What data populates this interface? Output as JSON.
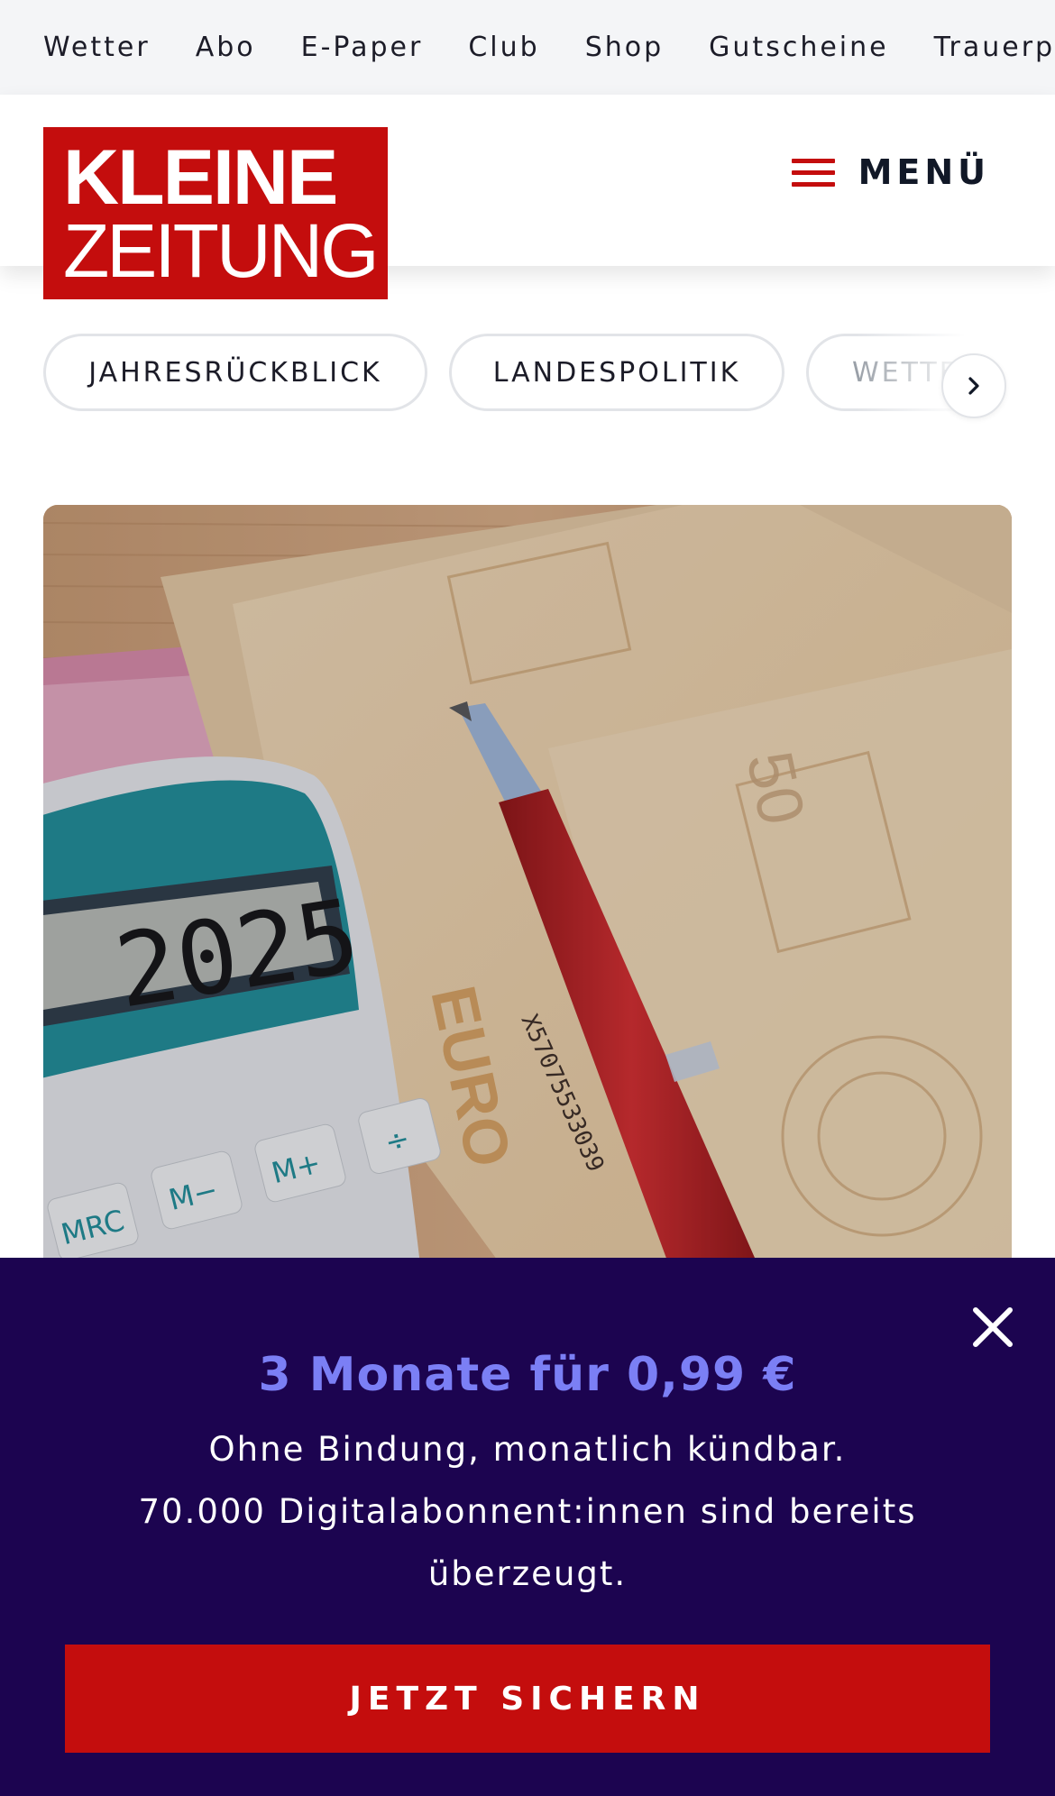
{
  "utility_nav": {
    "items": [
      "Wetter",
      "Abo",
      "E-Paper",
      "Club",
      "Shop",
      "Gutscheine",
      "Trauerportal"
    ]
  },
  "header": {
    "logo_line1": "KLEINE",
    "logo_line2": "ZEITUNG",
    "menu_label": "MENÜ",
    "brand_color": "#c40d0d"
  },
  "topics": {
    "items": [
      "JAHRESRÜCKBLICK",
      "LANDESPOLITIK",
      "WETTER"
    ],
    "next_icon": "chevron-right-icon"
  },
  "hero": {
    "calculator_display": "2025",
    "calculator_keys": [
      "MRC",
      "M−",
      "M+",
      "÷"
    ],
    "banknote_value": "50",
    "banknote_label": "EURO",
    "banknote_serial": "X57075533039"
  },
  "banner": {
    "headline": "3 Monate für 0,99 €",
    "line1": "Ohne Bindung, monatlich kündbar.",
    "line2": "70.000 Digitalabonnent:innen sind bereits überzeugt.",
    "cta_label": "JETZT SICHERN",
    "close_icon": "close-icon",
    "background_color": "#1c0450",
    "headline_color": "#7b7ff5"
  }
}
